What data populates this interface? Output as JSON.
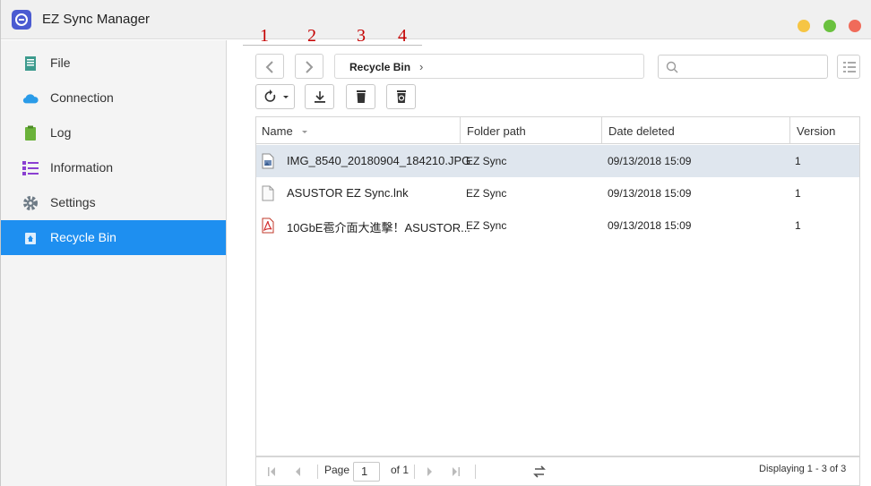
{
  "app": {
    "title": "EZ Sync Manager"
  },
  "sidebar": {
    "items": [
      {
        "label": "File",
        "icon": "file-icon"
      },
      {
        "label": "Connection",
        "icon": "cloud-icon"
      },
      {
        "label": "Log",
        "icon": "log-icon"
      },
      {
        "label": "Information",
        "icon": "information-icon"
      },
      {
        "label": "Settings",
        "icon": "gear-icon"
      },
      {
        "label": "Recycle Bin",
        "icon": "recycle-bin-icon",
        "active": true
      }
    ]
  },
  "breadcrumb": {
    "current": "Recycle Bin"
  },
  "search": {
    "placeholder": ""
  },
  "annotations": [
    "1",
    "2",
    "3",
    "4"
  ],
  "toolbar": {
    "buttons": [
      {
        "name": "restore-button",
        "icon": "restore-icon"
      },
      {
        "name": "download-button",
        "icon": "download-icon"
      },
      {
        "name": "delete-button",
        "icon": "trash-icon"
      },
      {
        "name": "empty-recycle-bin-button",
        "icon": "empty-bin-icon"
      }
    ]
  },
  "table": {
    "columns": [
      "Name",
      "Folder path",
      "Date deleted",
      "Version"
    ],
    "rows": [
      {
        "name": "IMG_8540_20180904_184210.JPG",
        "folder": "EZ Sync",
        "date": "09/13/2018 15:09",
        "version": "1",
        "icon": "image-file-icon",
        "selected": true
      },
      {
        "name": "ASUSTOR EZ Sync.lnk",
        "folder": "EZ Sync",
        "date": "09/13/2018 15:09",
        "version": "1",
        "icon": "generic-file-icon",
        "selected": false
      },
      {
        "name": "10GbE雹介面大進擊！ASUSTOR...",
        "folder": "EZ Sync",
        "date": "09/13/2018 15:09",
        "version": "1",
        "icon": "pdf-file-icon",
        "selected": false
      }
    ]
  },
  "pager": {
    "page_label": "Page",
    "page_value": "1",
    "of_label": "of 1",
    "display_text": "Displaying 1 - 3 of 3"
  },
  "colors": {
    "accent": "#1e8ff0",
    "annotation": "#c40000",
    "selected_row": "#dfe6ee"
  }
}
